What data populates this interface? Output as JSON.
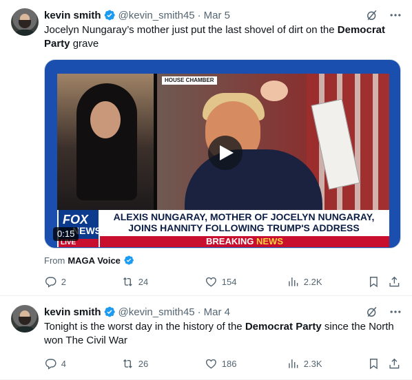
{
  "colors": {
    "accent": "#1d9bf0",
    "text": "#0f1419",
    "muted": "#536471",
    "border": "#eff3f4"
  },
  "tweets": [
    {
      "author_name": "kevin smith",
      "handle": "@kevin_smith45",
      "date": "Mar 5",
      "text_before": "Jocelyn Nungaray’s mother just put the last shovel of dirt on the ",
      "text_bold": "Democrat Party",
      "text_after": " grave",
      "media": {
        "duration": "0:15",
        "chamber_label": "HOUSE CHAMBER",
        "headline_1": "ALEXIS NUNGARAY, MOTHER OF JOCELYN NUNGARAY,",
        "headline_2": "JOINS HANNITY FOLLOWING TRUMP'S ADDRESS",
        "breaking_1": "BREAKING",
        "breaking_2": "NEWS",
        "logo_fox": "FOX",
        "logo_news": "NEWS",
        "logo_live": "LIVE"
      },
      "from_label": "From",
      "from_source": "MAGA Voice",
      "stats": {
        "replies": "2",
        "reposts": "24",
        "likes": "154",
        "views": "2.2K"
      }
    },
    {
      "author_name": "kevin smith",
      "handle": "@kevin_smith45",
      "date": "Mar 4",
      "text_before": "Tonight is the worst day in the history of the ",
      "text_bold": "Democrat Party",
      "text_after": " since the North won The Civil War",
      "stats": {
        "replies": "4",
        "reposts": "26",
        "likes": "186",
        "views": "2.3K"
      }
    }
  ],
  "icons": [
    "verified-badge-icon",
    "grok-icon",
    "more-icon",
    "play-icon",
    "reply-icon",
    "repost-icon",
    "like-icon",
    "views-icon",
    "bookmark-icon",
    "share-icon"
  ]
}
